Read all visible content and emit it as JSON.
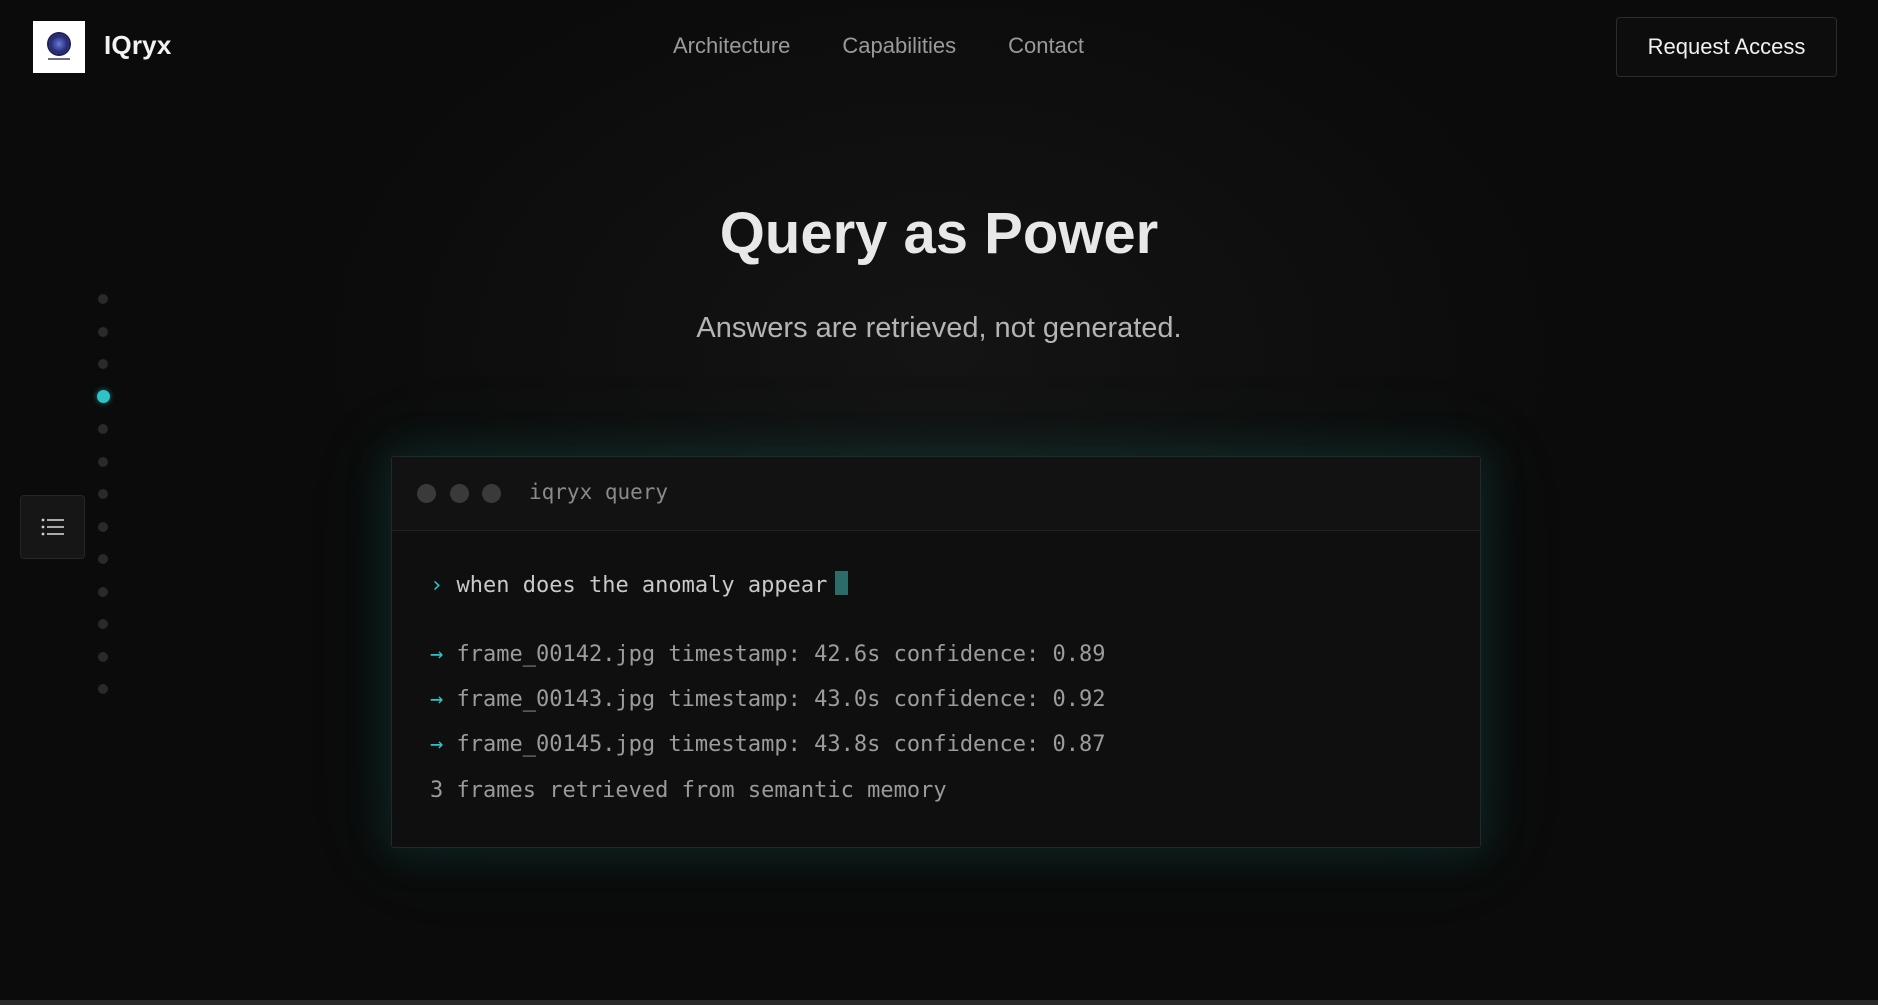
{
  "header": {
    "brand": "IQryx",
    "nav": [
      "Architecture",
      "Capabilities",
      "Contact"
    ],
    "cta_label": "Request Access"
  },
  "hero": {
    "title": "Query as Power",
    "subtitle": "Answers are retrieved, not generated."
  },
  "section_nav": {
    "total_dots": 13,
    "active_index": 3,
    "active_color": "#2ec4c7"
  },
  "menu_toggle": {
    "icon": "list-icon"
  },
  "terminal": {
    "title": "iqryx query",
    "prompt_symbol": "›",
    "query": "when does the anomaly appear",
    "result_symbol": "→",
    "results": [
      "frame_00142.jpg timestamp: 42.6s confidence: 0.89",
      "frame_00143.jpg timestamp: 43.0s confidence: 0.92",
      "frame_00145.jpg timestamp: 43.8s confidence: 0.87"
    ],
    "summary": "3 frames retrieved from semantic memory"
  },
  "colors": {
    "background": "#0b0b0b",
    "accent": "#2ec4c7",
    "caret": "#2b6b6a"
  }
}
